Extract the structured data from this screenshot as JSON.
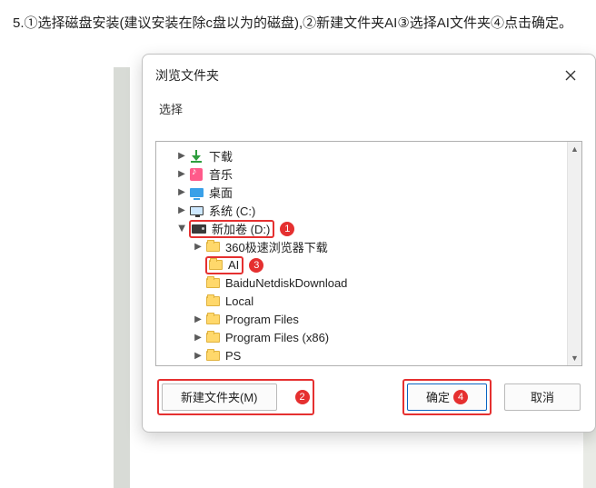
{
  "intro": "5.①选择磁盘安装(建议安装在除c盘以为的磁盘),②新建文件夹AI③选择AI文件夹④点击确定。",
  "dialog": {
    "title": "浏览文件夹",
    "prompt": "选择",
    "buttons": {
      "new_folder": "新建文件夹(M)",
      "ok": "确定",
      "cancel": "取消"
    }
  },
  "tree": {
    "downloads": "下载",
    "music": "音乐",
    "desktop": "桌面",
    "system_c": "系统 (C:)",
    "new_vol_d": "新加卷 (D:)",
    "d_children": {
      "browser_dl": "360极速浏览器下载",
      "ai": "AI",
      "baidu": "BaiduNetdiskDownload",
      "local": "Local",
      "pf": "Program Files",
      "pf86": "Program Files (x86)",
      "ps": "PS"
    }
  },
  "callouts": {
    "c1": "1",
    "c2": "2",
    "c3": "3",
    "c4": "4"
  }
}
